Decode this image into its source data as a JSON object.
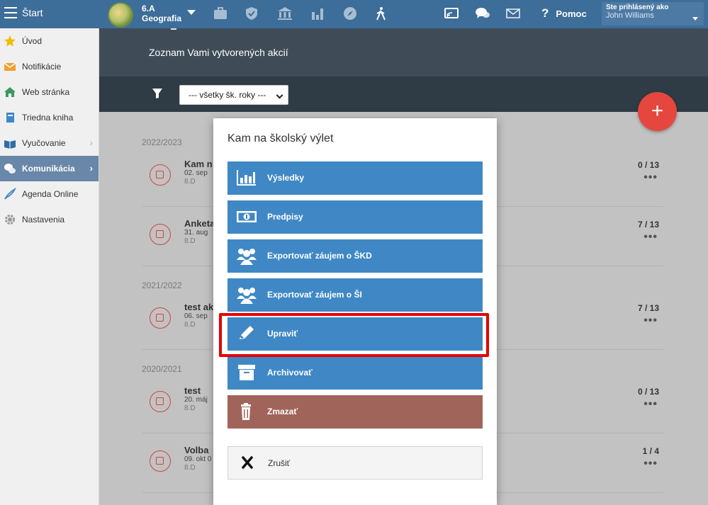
{
  "topbar": {
    "start_label": "Štart",
    "class_line1": "6.A",
    "class_line2": "Geografia",
    "help_label": "Pomoc",
    "user_caption": "Ste prihlásený ako",
    "user_name": "John Williams",
    "icons": [
      "briefcase-icon",
      "shield-icon",
      "bank-icon",
      "bar-chart-icon",
      "compass-icon",
      "hiking-icon",
      "cast-icon",
      "chat-icon",
      "mail-icon"
    ]
  },
  "sidebar": {
    "items": [
      {
        "label": "Úvod",
        "icon": "star-icon"
      },
      {
        "label": "Notifikácie",
        "icon": "envelope-icon"
      },
      {
        "label": "Web stránka",
        "icon": "home-icon"
      },
      {
        "label": "Triedna kniha",
        "icon": "notebook-icon"
      },
      {
        "label": "Vyučovanie",
        "icon": "book-icon"
      },
      {
        "label": "Komunikácia",
        "icon": "chat-bubbles-icon"
      },
      {
        "label": "Agenda Online",
        "icon": "quill-icon"
      },
      {
        "label": "Nastavenia",
        "icon": "gear-icon"
      }
    ]
  },
  "main": {
    "subtitle": "Zoznam Vami vytvorených akcií",
    "filter_value": "--- všetky šk. roky ---",
    "fab_label": "+",
    "years": [
      "2022/2023",
      "2021/2022",
      "2020/2021"
    ],
    "events": [
      {
        "name": "Kam n",
        "date": "02. sep",
        "cls": "8.D",
        "count": "0 / 13"
      },
      {
        "name": "Anketa",
        "date": "31. aug",
        "cls": "8.D",
        "count": "7 / 13"
      },
      {
        "name": "test ak",
        "date": "06. sep",
        "cls": "8.D",
        "count": "7 / 13"
      },
      {
        "name": "test",
        "date": "20. máj",
        "cls": "8.D",
        "count": "0 / 13"
      },
      {
        "name": "Volba",
        "date": "09. okt 0",
        "cls": "8.D",
        "count": "1 / 4"
      }
    ],
    "more_label": "•••"
  },
  "modal": {
    "title": "Kam na školský výlet",
    "buttons": {
      "results": "Výsledky",
      "fees": "Predpisy",
      "export_skd": "Exportovať záujem o ŠKD",
      "export_si": "Exportovať záujem o ŠI",
      "edit": "Upraviť",
      "archive": "Archivovať",
      "delete": "Zmazať",
      "cancel": "Zrušiť"
    }
  },
  "colors": {
    "topbar": "#3d6d99",
    "primary_button": "#3f88c5",
    "danger_button": "#a0645a",
    "fab": "#e5473e",
    "highlight": "#e60000"
  }
}
